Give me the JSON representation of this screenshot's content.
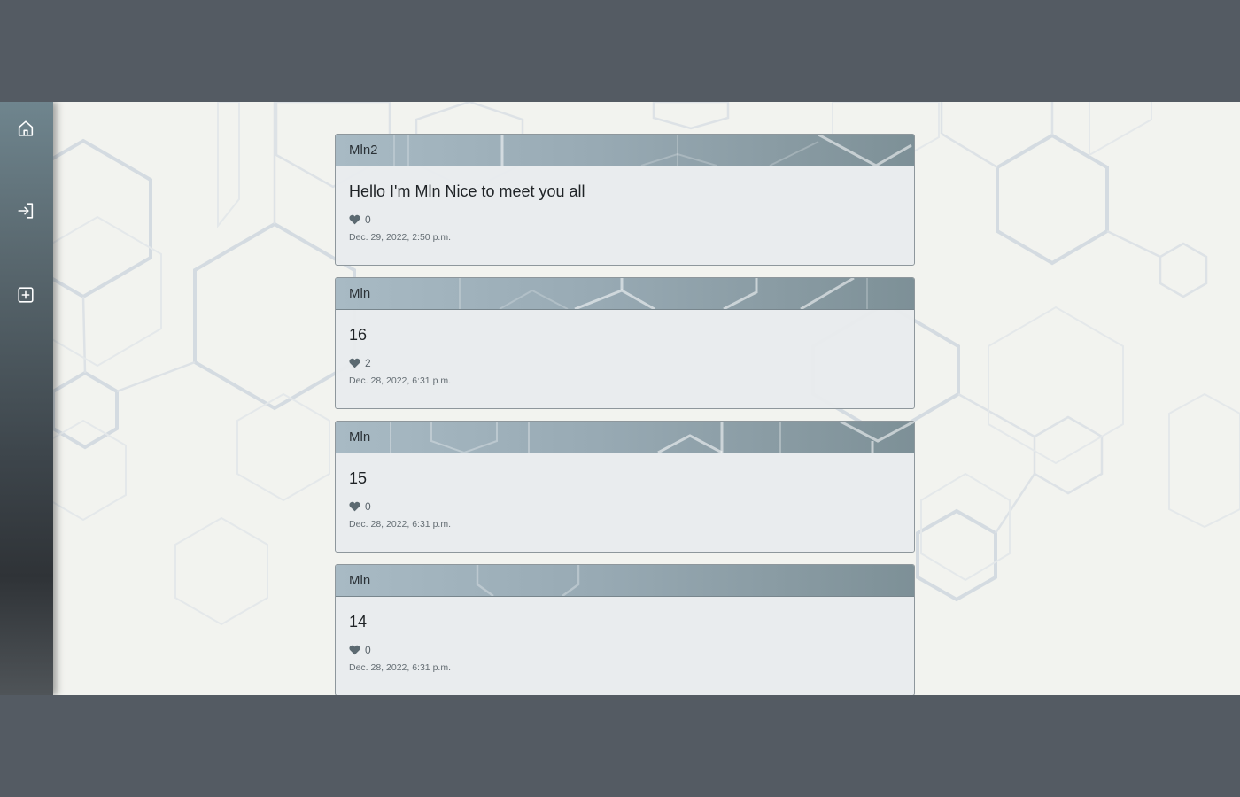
{
  "nav": {
    "items": [
      {
        "name": "home",
        "icon": "home-icon"
      },
      {
        "name": "login",
        "icon": "login-icon"
      },
      {
        "name": "new-post",
        "icon": "plus-square-icon"
      }
    ]
  },
  "posts": [
    {
      "author": "Mln2",
      "content": "Hello I'm Mln Nice to meet you all",
      "likes": "0",
      "date": "Dec. 29, 2022, 2:50 p.m."
    },
    {
      "author": "Mln",
      "content": "16",
      "likes": "2",
      "date": "Dec. 28, 2022, 6:31 p.m."
    },
    {
      "author": "Mln",
      "content": "15",
      "likes": "0",
      "date": "Dec. 28, 2022, 6:31 p.m."
    },
    {
      "author": "Mln",
      "content": "14",
      "likes": "0",
      "date": "Dec. 28, 2022, 6:31 p.m."
    }
  ],
  "colors": {
    "outer": "#545b63",
    "page_background": "#f2f3ef",
    "card_header": "#98aab4",
    "card_body": "#e8ebed",
    "heart": "#5c6a71"
  }
}
